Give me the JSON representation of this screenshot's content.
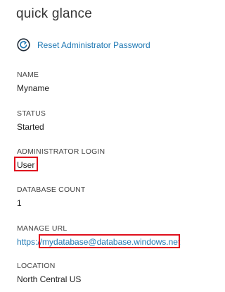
{
  "panel": {
    "title": "quick glance"
  },
  "actions": {
    "reset_password_label": "Reset Administrator Password",
    "reset_icon": "refresh-circle-icon"
  },
  "fields": {
    "name": {
      "label": "NAME",
      "value": "Myname"
    },
    "status": {
      "label": "STATUS",
      "value": "Started"
    },
    "admin_login": {
      "label": "ADMINISTRATOR LOGIN",
      "value": "User"
    },
    "database_count": {
      "label": "DATABASE COUNT",
      "value": "1"
    },
    "manage_url": {
      "label": "MANAGE URL",
      "value": "https://mydatabase@database.windows.net"
    },
    "location": {
      "label": "LOCATION",
      "value": "North Central US"
    }
  },
  "colors": {
    "link": "#1e78b4",
    "highlight": "#e0101d"
  }
}
